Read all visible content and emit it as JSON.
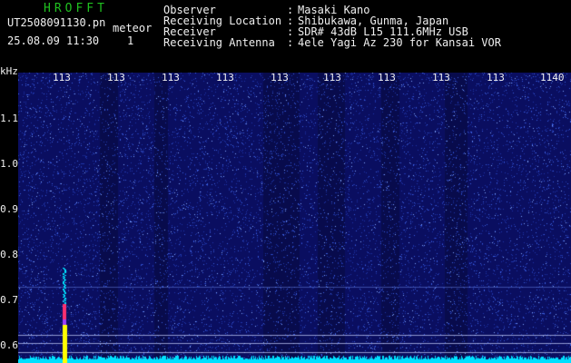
{
  "header": {
    "app_title": "HROFFT",
    "file_name": "UT2508091130.pn",
    "event_tag": "meteor",
    "date_time": "25.08.09 11:30",
    "counter": "1",
    "info": [
      {
        "key": "Observer",
        "value": "Masaki Kano"
      },
      {
        "key": "Receiving Location",
        "value": "Shibukawa, Gunma, Japan"
      },
      {
        "key": "Receiver",
        "value": "SDR# 43dB L15 111.6MHz USB"
      },
      {
        "key": "Receiving Antenna",
        "value": "4ele Yagi Az 230 for Kansai VOR"
      }
    ],
    "separator": ":"
  },
  "plot": {
    "y_unit": "kHz",
    "y_ticks": [
      "1.1",
      "1.0",
      "0.9",
      "0.8",
      "0.7",
      "0.6"
    ],
    "x_ticks": [
      "113",
      "113",
      "113",
      "113",
      "113",
      "113",
      "113",
      "113",
      "113",
      "1140"
    ],
    "colors": {
      "background": "#0a0e60",
      "noise": "#4a7cff",
      "signal_low": "#00e0ff",
      "signal_mid": "#ff3070",
      "signal_high": "#ffff00"
    }
  }
}
